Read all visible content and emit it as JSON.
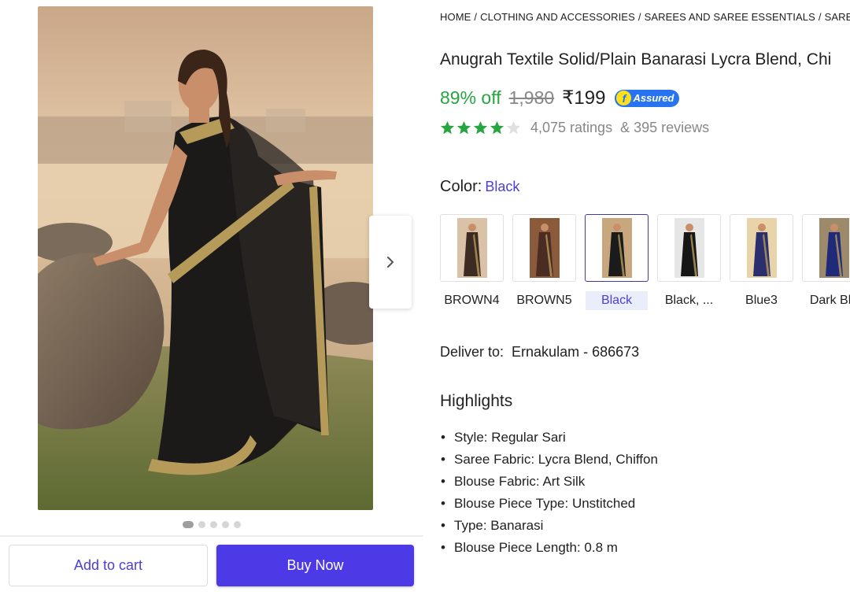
{
  "breadcrumb": [
    "HOME",
    "CLOTHING AND ACCESSORIES",
    "SAREES AND SAREE ESSENTIALS",
    "SAREE"
  ],
  "product": {
    "title": "Anugrah Textile Solid/Plain Banarasi Lycra Blend, Chi",
    "discount": "89% off",
    "mrp": "1,980",
    "price": "₹199",
    "assured_label": "Assured",
    "rating_stars": 4,
    "ratings_text": "4,075 ratings",
    "reviews_text": "& 395 reviews"
  },
  "gallery": {
    "dot_count": 5,
    "active_dot": 0,
    "next_icon": "chevron-right-icon"
  },
  "actions": {
    "add_to_cart": "Add to cart",
    "buy_now": "Buy Now"
  },
  "color": {
    "label": "Color:",
    "selected": "Black",
    "options": [
      {
        "label": "BROWN4",
        "dress": "#3b2b22",
        "bg": "#d9c2a6"
      },
      {
        "label": "BROWN5",
        "dress": "#4a2c22",
        "bg": "#8a5a3a"
      },
      {
        "label": "Black",
        "dress": "#1b1b1b",
        "bg": "#c9a77e"
      },
      {
        "label": "Black, ...",
        "dress": "#161616",
        "bg": "#e6e6e6"
      },
      {
        "label": "Blue3",
        "dress": "#2b2f6e",
        "bg": "#e9d3a8"
      },
      {
        "label": "Dark Blu",
        "dress": "#1f2a7a",
        "bg": "#9c8a6a"
      }
    ],
    "selected_index": 2
  },
  "delivery": {
    "label": "Deliver to:",
    "location": "Ernakulam - 686673"
  },
  "highlights": {
    "title": "Highlights",
    "items": [
      "Style: Regular Sari",
      "Saree Fabric: Lycra Blend, Chiffon",
      "Blouse Fabric: Art Silk",
      "Blouse Piece Type: Unstitched",
      "Type: Banarasi",
      "Blouse Piece Length: 0.8 m"
    ]
  },
  "colors": {
    "accent": "#4c3ae6",
    "discount_green": "#26a541",
    "assured_blue": "#2874f0"
  }
}
